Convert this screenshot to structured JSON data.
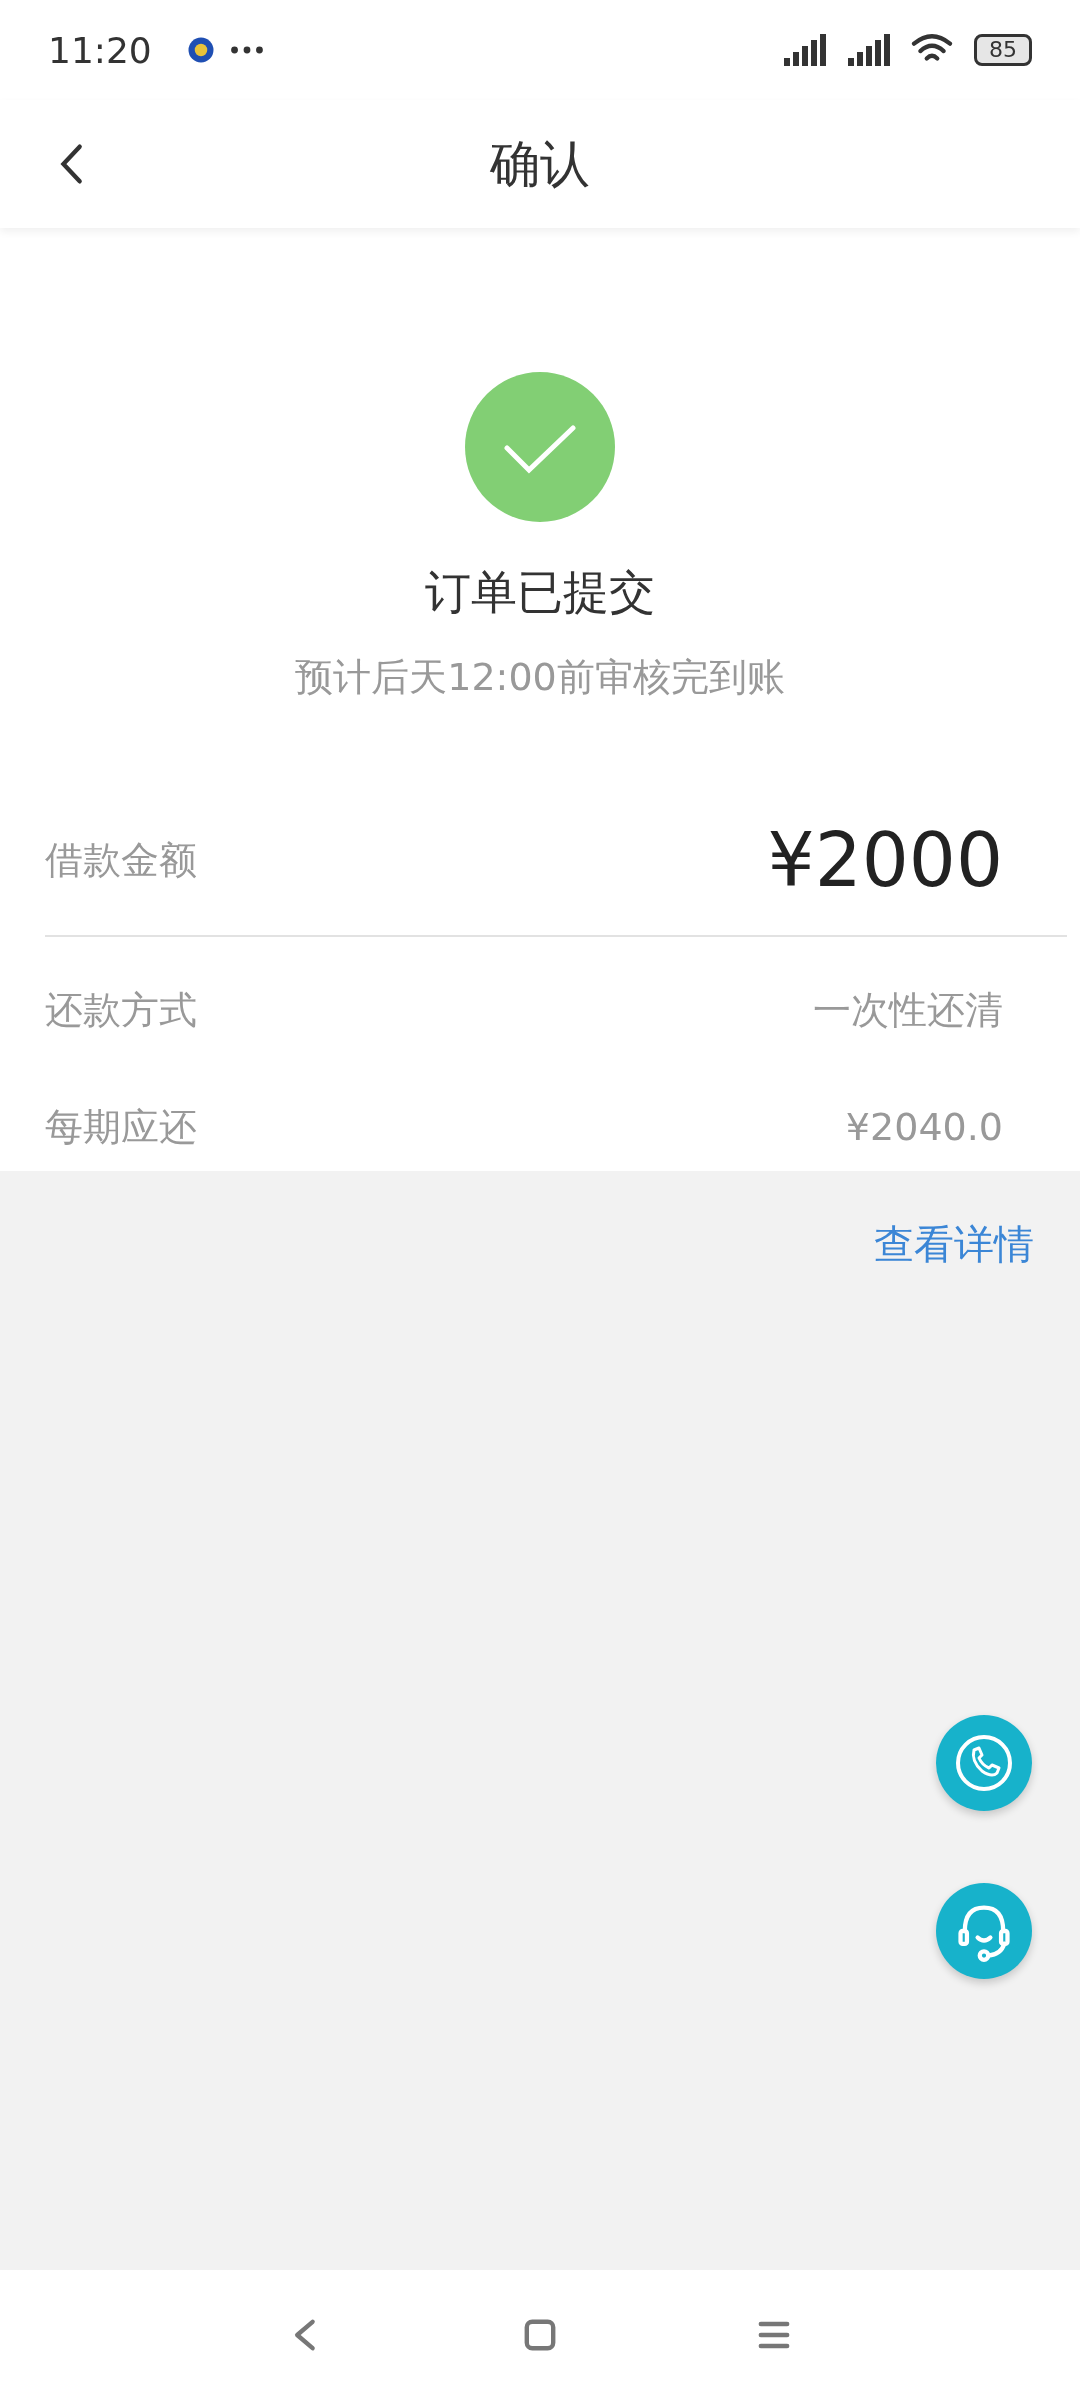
{
  "status_bar": {
    "time": "11:20",
    "battery": "85"
  },
  "header": {
    "title": "确认"
  },
  "result": {
    "title": "订单已提交",
    "subtitle": "预计后天12:00前审核完到账"
  },
  "rows": [
    {
      "kind": "amount",
      "label": "借款金额",
      "value": "¥2000"
    },
    {
      "kind": "plain",
      "label": "还款方式",
      "value": "一次性还清"
    },
    {
      "kind": "plain",
      "label": "每期应还",
      "value": "¥2040.0"
    }
  ],
  "details_link": "查看详情"
}
